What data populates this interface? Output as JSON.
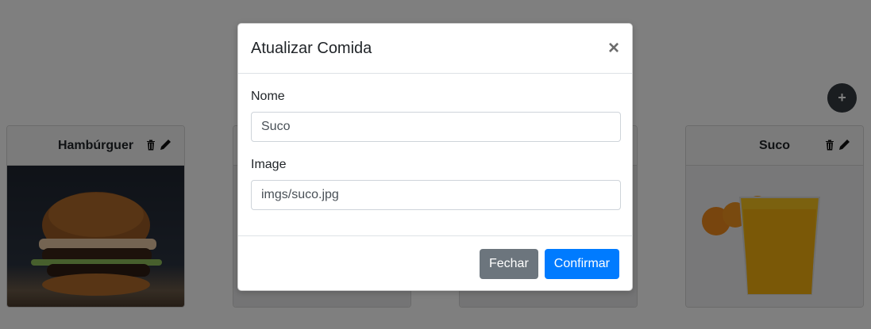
{
  "page": {
    "add_button_label": "+",
    "cards": [
      {
        "title": "Hambúrguer",
        "delete_icon": "trash-icon",
        "edit_icon": "pencil-icon"
      },
      {
        "title": "Suco",
        "delete_icon": "trash-icon",
        "edit_icon": "pencil-icon"
      }
    ]
  },
  "modal": {
    "title": "Atualizar Comida",
    "close_label": "×",
    "fields": {
      "name_label": "Nome",
      "name_value": "Suco",
      "image_label": "Image",
      "image_value": "imgs/suco.jpg"
    },
    "buttons": {
      "close_label": "Fechar",
      "confirm_label": "Confirmar"
    }
  },
  "colors": {
    "primary": "#007bff",
    "secondary": "#6c757d",
    "dark": "#343a40"
  }
}
